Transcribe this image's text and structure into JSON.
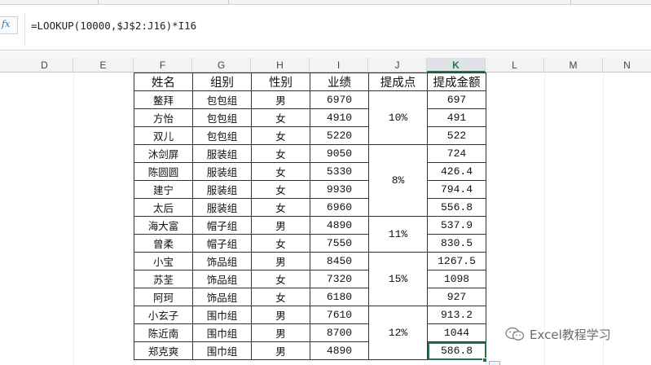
{
  "formula_bar": {
    "fx_label": "fx",
    "formula": "=LOOKUP(10000,$J$2:J16)*I16"
  },
  "columns": {
    "D": "D",
    "E": "E",
    "F": "F",
    "G": "G",
    "H": "H",
    "I": "I",
    "J": "J",
    "K": "K",
    "L": "L",
    "M": "M",
    "N": "N"
  },
  "table": {
    "headers": {
      "name": "姓名",
      "group": "组别",
      "gender": "性别",
      "sales": "业绩",
      "rate": "提成点",
      "commission": "提成金额"
    },
    "rows": [
      {
        "name": "鳌拜",
        "group": "包包组",
        "gender": "男",
        "sales": "6970",
        "commission": "697"
      },
      {
        "name": "方怡",
        "group": "包包组",
        "gender": "女",
        "sales": "4910",
        "commission": "491"
      },
      {
        "name": "双儿",
        "group": "包包组",
        "gender": "女",
        "sales": "5220",
        "commission": "522"
      },
      {
        "name": "沐剑屏",
        "group": "服装组",
        "gender": "女",
        "sales": "9050",
        "commission": "724"
      },
      {
        "name": "陈圆圆",
        "group": "服装组",
        "gender": "女",
        "sales": "5330",
        "commission": "426.4"
      },
      {
        "name": "建宁",
        "group": "服装组",
        "gender": "女",
        "sales": "9930",
        "commission": "794.4"
      },
      {
        "name": "太后",
        "group": "服装组",
        "gender": "女",
        "sales": "6960",
        "commission": "556.8"
      },
      {
        "name": "海大富",
        "group": "帽子组",
        "gender": "男",
        "sales": "4890",
        "commission": "537.9"
      },
      {
        "name": "曾柔",
        "group": "帽子组",
        "gender": "女",
        "sales": "7550",
        "commission": "830.5"
      },
      {
        "name": "小宝",
        "group": "饰品组",
        "gender": "男",
        "sales": "8450",
        "commission": "1267.5"
      },
      {
        "name": "苏荃",
        "group": "饰品组",
        "gender": "女",
        "sales": "7320",
        "commission": "1098"
      },
      {
        "name": "阿珂",
        "group": "饰品组",
        "gender": "女",
        "sales": "6180",
        "commission": "927"
      },
      {
        "name": "小玄子",
        "group": "围巾组",
        "gender": "男",
        "sales": "7610",
        "commission": "913.2"
      },
      {
        "name": "陈近南",
        "group": "围巾组",
        "gender": "男",
        "sales": "8700",
        "commission": "1044"
      },
      {
        "name": "郑克爽",
        "group": "围巾组",
        "gender": "男",
        "sales": "4890",
        "commission": "586.8"
      }
    ],
    "rates": [
      "10%",
      "8%",
      "11%",
      "15%",
      "12%"
    ]
  },
  "watermark": {
    "text": "Excel教程学习",
    "icon": "wechat-icon"
  },
  "colors": {
    "accent": "#217346",
    "grid_border": "#333333",
    "header_bg": "#f3f3f3"
  }
}
